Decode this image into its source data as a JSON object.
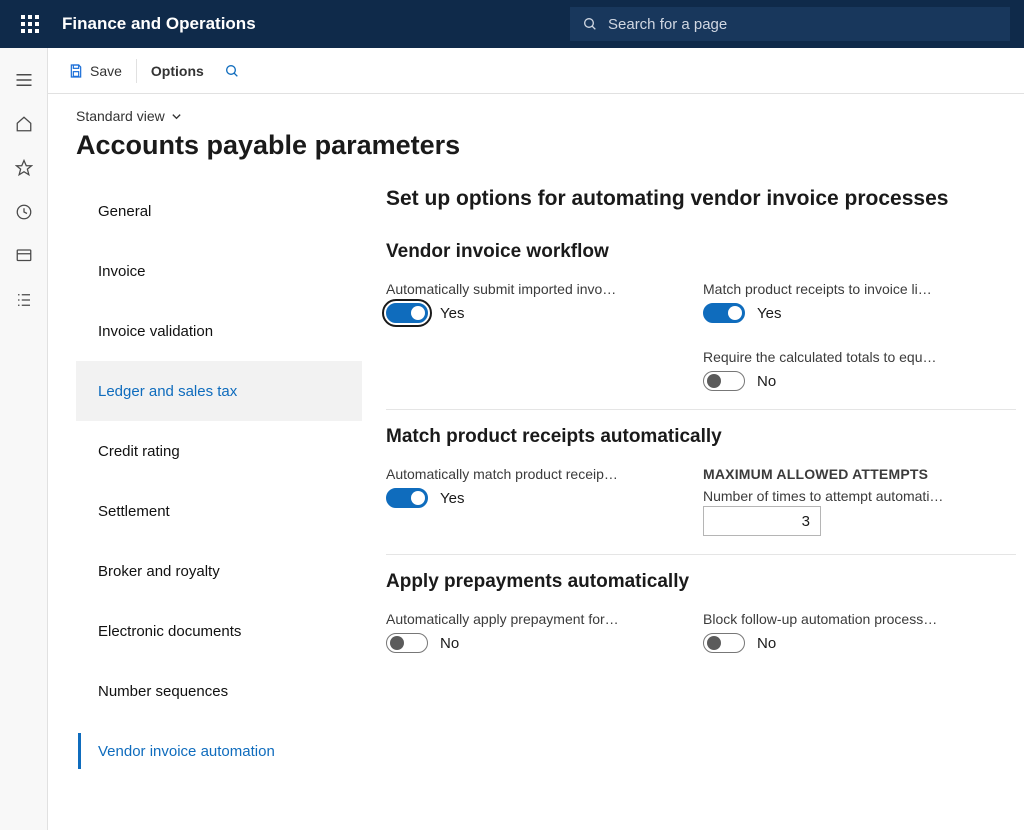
{
  "topnav": {
    "brand": "Finance and Operations",
    "search_placeholder": "Search for a page"
  },
  "cmdbar": {
    "save": "Save",
    "options": "Options"
  },
  "page": {
    "view_label": "Standard view",
    "title": "Accounts payable parameters"
  },
  "sidenav": [
    "General",
    "Invoice",
    "Invoice validation",
    "Ledger and sales tax",
    "Credit rating",
    "Settlement",
    "Broker and royalty",
    "Electronic documents",
    "Number sequences",
    "Vendor invoice automation"
  ],
  "settings": {
    "heading": "Set up options for automating vendor invoice processes",
    "section1": {
      "title": "Vendor invoice workflow",
      "auto_submit_label": "Automatically submit imported invo…",
      "auto_submit_value": "Yes",
      "match_receipts_label": "Match product receipts to invoice li…",
      "match_receipts_value": "Yes",
      "require_totals_label": "Require the calculated totals to equ…",
      "require_totals_value": "No"
    },
    "section2": {
      "title": "Match product receipts automatically",
      "auto_match_label": "Automatically match product receip…",
      "auto_match_value": "Yes",
      "max_attempts_heading": "MAXIMUM ALLOWED ATTEMPTS",
      "max_attempts_label": "Number of times to attempt automati…",
      "max_attempts_value": "3"
    },
    "section3": {
      "title": "Apply prepayments automatically",
      "auto_prepay_label": "Automatically apply prepayment for…",
      "auto_prepay_value": "No",
      "block_followup_label": "Block follow-up automation process…",
      "block_followup_value": "No"
    }
  }
}
